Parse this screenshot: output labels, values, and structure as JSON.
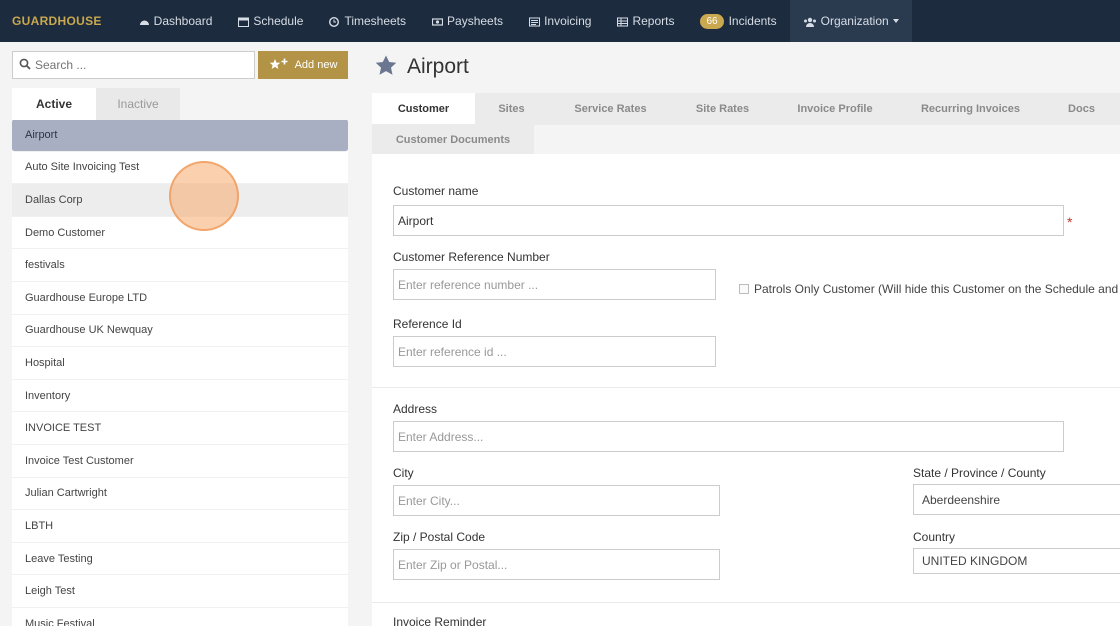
{
  "nav": {
    "brand": "GUARDHOUSE",
    "items": [
      {
        "label": "Dashboard",
        "icon": "dashboard-icon"
      },
      {
        "label": "Schedule",
        "icon": "calendar-icon"
      },
      {
        "label": "Timesheets",
        "icon": "clock-icon"
      },
      {
        "label": "Paysheets",
        "icon": "money-icon"
      },
      {
        "label": "Invoicing",
        "icon": "invoice-icon"
      },
      {
        "label": "Reports",
        "icon": "table-icon"
      }
    ],
    "incidents_count": "66",
    "incidents_label": "Incidents",
    "organization_label": "Organization"
  },
  "sidebar": {
    "search_placeholder": "Search ...",
    "add_label": "Add new",
    "tabs": [
      "Active",
      "Inactive"
    ],
    "customers": [
      "Airport",
      "Auto Site Invoicing Test",
      "Dallas Corp",
      "Demo Customer",
      "festivals",
      "Guardhouse Europe LTD",
      "Guardhouse UK Newquay",
      "Hospital",
      "Inventory",
      "INVOICE TEST",
      "Invoice Test Customer",
      "Julian Cartwright",
      "LBTH",
      "Leave Testing",
      "Leigh Test",
      "Music Festival"
    ]
  },
  "main": {
    "title": "Airport",
    "tabs_row1": [
      "Customer",
      "Sites",
      "Service Rates",
      "Site Rates",
      "Invoice Profile",
      "Recurring Invoices",
      "Docs"
    ],
    "tabs_row2": [
      "Customer Documents"
    ],
    "form": {
      "customer_name_label": "Customer name",
      "customer_name_value": "Airport",
      "ref_number_label": "Customer Reference Number",
      "ref_number_placeholder": "Enter reference number ...",
      "patrols_label": "Patrols Only Customer (Will hide this Customer on the Schedule and Tim",
      "ref_id_label": "Reference Id",
      "ref_id_placeholder": "Enter reference id ...",
      "address_label": "Address",
      "address_placeholder": "Enter Address...",
      "city_label": "City",
      "city_placeholder": "Enter City...",
      "state_label": "State / Province / County",
      "state_value": "Aberdeenshire",
      "zip_label": "Zip / Postal Code",
      "zip_placeholder": "Enter Zip or Postal...",
      "country_label": "Country",
      "country_value": "UNITED KINGDOM",
      "invoice_reminder_label": "Invoice Reminder",
      "required_mark": "*"
    }
  }
}
